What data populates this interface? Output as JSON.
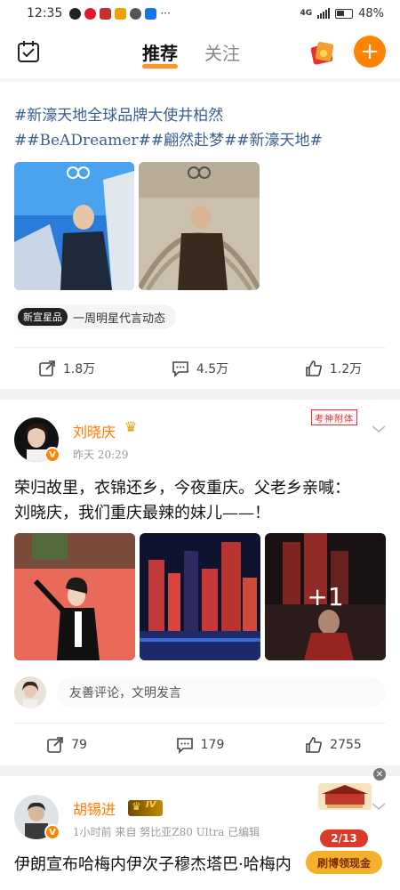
{
  "status_bar": {
    "time": "12:35",
    "dots": "···",
    "network": "4G",
    "battery": "48%"
  },
  "nav": {
    "tabs": [
      {
        "label": "推荐",
        "active": true
      },
      {
        "label": "关注",
        "active": false
      }
    ],
    "add_label": "+"
  },
  "post1": {
    "hashtag_line1": "#新濠天地全球品牌大使井柏然",
    "hashtag_line2": "##BeADreamer##翩然赴梦##新濠天地#",
    "topic_badge": "新宣星品",
    "topic_text": "一周明星代言动态",
    "actions": {
      "repost": "1.8万",
      "comment": "4.5万",
      "like": "1.2万"
    }
  },
  "post2": {
    "username": "刘晓庆",
    "time": "昨天 20:29",
    "stamp": "考神附体",
    "text_line1": "荣归故里，衣锦还乡，今夜重庆。父老乡亲喊：",
    "text_line2": "刘晓庆，我们重庆最辣的妹儿——！",
    "more_images": "+1",
    "comment_placeholder": "友善评论，文明发言",
    "actions": {
      "repost": "79",
      "comment": "179",
      "like": "2755"
    }
  },
  "post3": {
    "username": "胡锡进",
    "vip": "IV",
    "meta": "1小时前  来自 努比亚Z80 Ultra  已编辑",
    "text_line1": "伊朗宣布哈梅内伊次子穆杰塔巴·哈梅内"
  },
  "floating": {
    "close": "✕",
    "progress": "2/13",
    "cta": "刷博领现金"
  },
  "colors": {
    "accent": "#ff8200",
    "link": "#3a5f8c",
    "username": "#ff7a00"
  }
}
